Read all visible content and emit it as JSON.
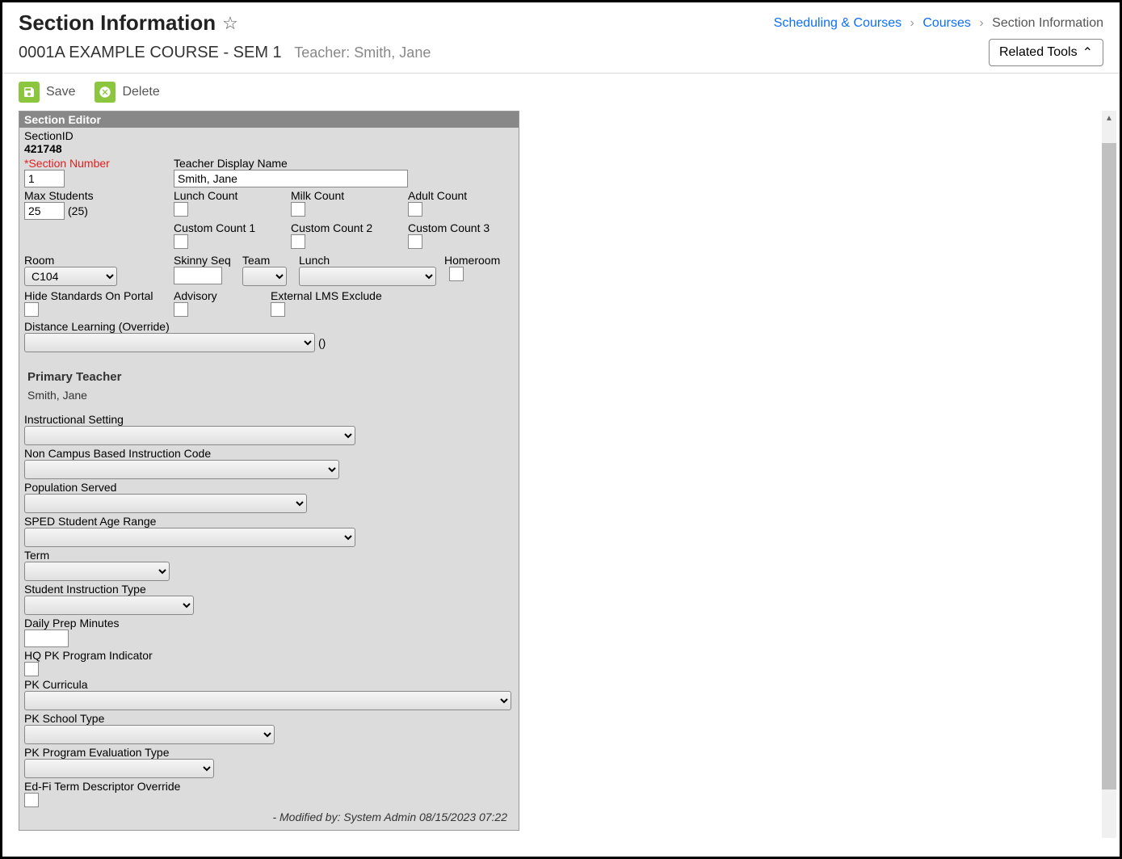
{
  "header": {
    "page_title": "Section Information",
    "breadcrumb": {
      "level1": "Scheduling & Courses",
      "level2": "Courses",
      "level3": "Section Information"
    },
    "subtitle_course": "0001A EXAMPLE COURSE - SEM 1",
    "subtitle_teacher": "Teacher: Smith, Jane",
    "related_tools": "Related Tools"
  },
  "toolbar": {
    "save_label": "Save",
    "delete_label": "Delete"
  },
  "editor": {
    "title": "Section Editor",
    "section_id_label": "SectionID",
    "section_id_value": "421748",
    "section_number_label": "*Section Number",
    "section_number_value": "1",
    "teacher_display_label": "Teacher Display Name",
    "teacher_display_value": "Smith, Jane",
    "max_students_label": "Max Students",
    "max_students_value": "25",
    "max_students_aside": "(25)",
    "counts": {
      "lunch": "Lunch Count",
      "milk": "Milk Count",
      "adult": "Adult Count",
      "custom1": "Custom Count 1",
      "custom2": "Custom Count 2",
      "custom3": "Custom Count 3"
    },
    "room_label": "Room",
    "room_value": "C104",
    "skinny_seq_label": "Skinny Seq",
    "team_label": "Team",
    "lunch_label": "Lunch",
    "homeroom_label": "Homeroom",
    "hide_standards_label": "Hide Standards On Portal",
    "advisory_label": "Advisory",
    "external_lms_label": "External LMS Exclude",
    "distance_learning_label": "Distance Learning (Override)",
    "distance_learning_aside": "()",
    "primary_teacher_title": "Primary Teacher",
    "primary_teacher_name": "Smith, Jane",
    "instructional_setting_label": "Instructional Setting",
    "non_campus_label": "Non Campus Based Instruction Code",
    "population_served_label": "Population Served",
    "sped_age_label": "SPED Student Age Range",
    "term_label": "Term",
    "student_instruction_label": "Student Instruction Type",
    "daily_prep_label": "Daily Prep Minutes",
    "hq_pk_label": "HQ PK Program Indicator",
    "pk_curricula_label": "PK Curricula",
    "pk_school_type_label": "PK School Type",
    "pk_program_eval_label": "PK Program Evaluation Type",
    "edfi_term_label": "Ed-Fi Term Descriptor Override",
    "modified": "- Modified by: System Admin 08/15/2023 07:22"
  }
}
